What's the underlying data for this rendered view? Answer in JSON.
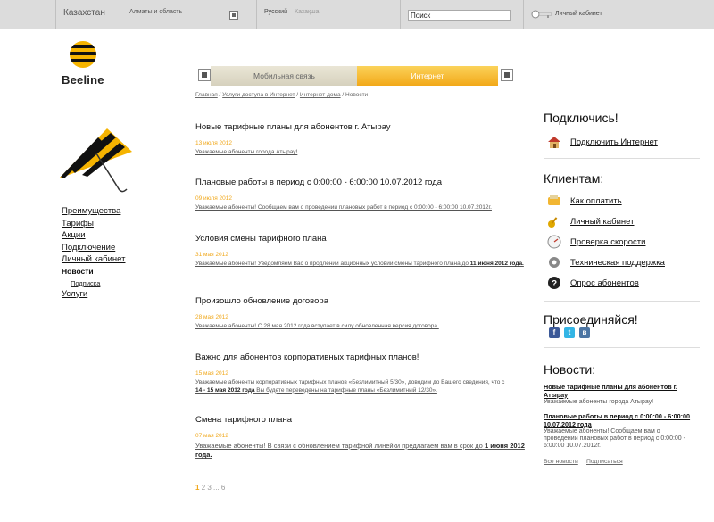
{
  "topbar": {
    "country": "Казахстан",
    "city": "Алматы и область",
    "lang_ru": "Русский",
    "lang_kz": "Казақша",
    "search_placeholder": "Поиск",
    "cabinet": "Личный кабинет"
  },
  "logo": {
    "text": "Beeline"
  },
  "tabs": {
    "mobile": "Мобильная связь",
    "internet": "Интернет"
  },
  "breadcrumb": {
    "items": [
      "Главная",
      "Услуги доступа в Интернет",
      "Интернет дома"
    ],
    "current": "Новости"
  },
  "left_nav": {
    "items": [
      "Преимущества",
      "Тарифы",
      "Акции",
      "Подключение",
      "Личный кабинет"
    ],
    "active": "Новости",
    "sub": "Подписка",
    "last": "Услуги"
  },
  "news": [
    {
      "title": "Новые тарифные планы для абонентов г. Атырау",
      "date": "13 июля 2012",
      "excerpt": "Уважаемые абоненты города Атырау!"
    },
    {
      "title": "Плановые работы в период с 0:00:00 - 6:00:00 10.07.2012 года",
      "date": "09 июля 2012",
      "excerpt": "Уважаемые абоненты! Сообщаем вам о проведении плановых работ в период с 0:00:00 - 6:00:00 10.07.2012г."
    },
    {
      "title": "Условия смены тарифного плана",
      "date": "31 мая 2012",
      "excerpt": "Уважаемые абоненты! Уведомляем Вас о продлении акционных условий смены тарифного плана до",
      "excerpt_bold": "11 июня 2012 года."
    },
    {
      "title": "Произошло обновление договора",
      "date": "28 мая 2012",
      "excerpt": "Уважаемые абоненты! С 28 мая 2012 года вступает в силу обновленная версия договора."
    },
    {
      "title": "Важно для абонентов корпоративных тарифных планов!",
      "date": "15 мая 2012",
      "excerpt_l1": "Уважаемые абоненты корпоративных тарифных планов «Безлимитный 5/30», доводим до Вашего сведения, что с",
      "excerpt_l2_bold": "14 - 15 мая 2012 года",
      "excerpt_l2": " Вы будете переведены на тарифные планы «Безлимитный 12/30»."
    },
    {
      "title": "Смена тарифного плана",
      "date": "07 мая 2012",
      "excerpt": "Уважаемые абоненты! В связи с обновлением тарифной линейки предлагаем вам в срок до",
      "excerpt_bold": "1 июня 2012 года."
    }
  ],
  "pager": {
    "current": "1",
    "pages": "2 3 ... 6"
  },
  "right": {
    "connect_title": "Подключись!",
    "connect_link": "Подключить Интернет",
    "clients_title": "Клиентам:",
    "clients_links": [
      "Как оплатить",
      "Личный кабинет",
      "Проверка скорости",
      "Техническая поддержка",
      "Опрос абонентов"
    ],
    "join_title": "Присоединяйся!",
    "news_title": "Новости:",
    "news": [
      {
        "title": "Новые тарифные планы для абонентов г. Атырау",
        "excerpt": "Уважаемые абоненты города Атырау!"
      },
      {
        "title": "Плановые работы в период с 0:00:00 - 6:00:00 10.07.2012 года",
        "excerpt": "Уважаемые абоненты! Сообщаем вам о проведении плановых работ в период с 0:00:00 - 6:00:00 10.07.2012г."
      }
    ],
    "all_news": "Все новости",
    "subscribe": "Подписаться"
  },
  "colors": {
    "accent": "#f0a81c",
    "tab_internet": "#f2a818",
    "tab_mobile": "#dcd7c3"
  }
}
